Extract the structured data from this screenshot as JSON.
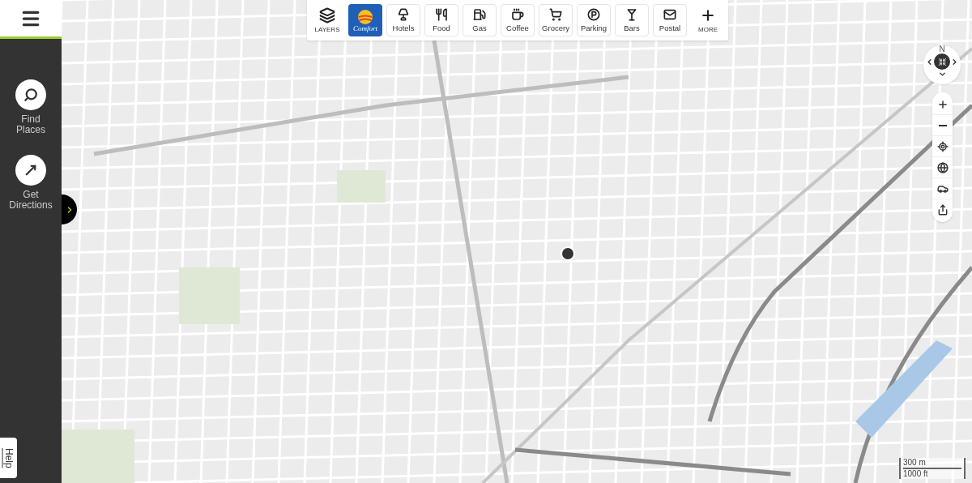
{
  "sidebar": {
    "items": [
      {
        "label": "Find Places",
        "kind": "search"
      },
      {
        "label": "Get Directions",
        "kind": "directions"
      }
    ],
    "help": "Help"
  },
  "toolbar": {
    "items": [
      {
        "label": "LAYERS",
        "kind": "layers"
      },
      {
        "label": "Comfort",
        "kind": "brand"
      },
      {
        "label": "Hotels",
        "kind": "hotels"
      },
      {
        "label": "Food",
        "kind": "food"
      },
      {
        "label": "Gas",
        "kind": "gas"
      },
      {
        "label": "Coffee",
        "kind": "coffee"
      },
      {
        "label": "Grocery",
        "kind": "grocery"
      },
      {
        "label": "Parking",
        "kind": "parking"
      },
      {
        "label": "Bars",
        "kind": "bars"
      },
      {
        "label": "Postal",
        "kind": "postal"
      },
      {
        "label": "MORE",
        "kind": "more"
      }
    ]
  },
  "compass": {
    "label": "N"
  },
  "scale": {
    "metric": "300 m",
    "imperial": "1000 ft"
  }
}
